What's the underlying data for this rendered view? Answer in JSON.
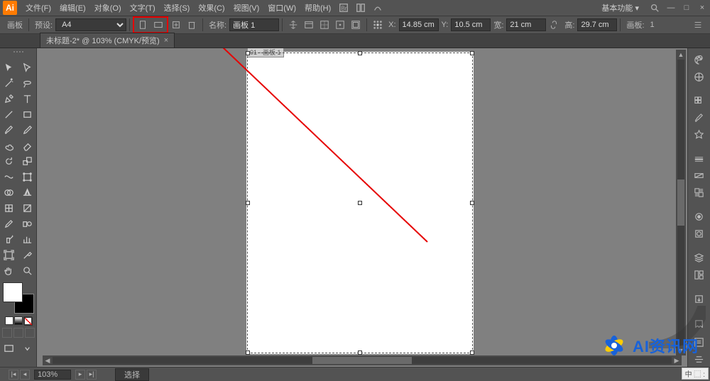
{
  "app": {
    "logo": "Ai",
    "workspace": "基本功能",
    "window": {
      "min": "—",
      "max": "□",
      "close": "×"
    }
  },
  "menu": {
    "file": "文件(F)",
    "edit": "编辑(E)",
    "object": "对象(O)",
    "type": "文字(T)",
    "select": "选择(S)",
    "effect": "效果(C)",
    "view": "视图(V)",
    "window": "窗口(W)",
    "help": "帮助(H)"
  },
  "options": {
    "artboard_label": "画板",
    "preset_label": "预设:",
    "preset_value": "A4",
    "name_label": "名称:",
    "name_value": "画板 1",
    "x_label": "X:",
    "x_value": "14.85 cm",
    "y_label": "Y:",
    "y_value": "10.5 cm",
    "w_label": "宽:",
    "w_value": "21 cm",
    "h_label": "高:",
    "h_value": "29.7 cm",
    "artboards_label": "画板:",
    "artboards_value": "1"
  },
  "tab": {
    "title": "未标题-2* @ 103% (CMYK/预览)"
  },
  "artboard": {
    "mini_label": "01 - 画板 1"
  },
  "status": {
    "zoom": "103%",
    "mode": "选择"
  },
  "ime": "中 ⬚ :",
  "watermark": "AI资讯网"
}
